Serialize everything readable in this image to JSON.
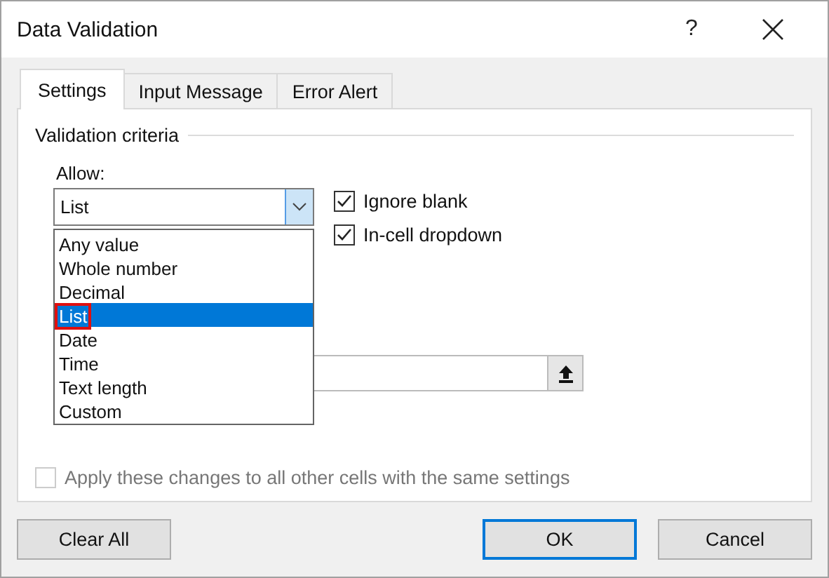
{
  "window": {
    "title": "Data Validation",
    "help": "?"
  },
  "tabs": [
    {
      "label": "Settings",
      "selected": true
    },
    {
      "label": "Input Message",
      "selected": false
    },
    {
      "label": "Error Alert",
      "selected": false
    }
  ],
  "section": {
    "title": "Validation criteria"
  },
  "allow": {
    "label": "Allow:",
    "value": "List",
    "expanded": true,
    "options": [
      {
        "label": "Any value",
        "selected": false,
        "annotated": false
      },
      {
        "label": "Whole number",
        "selected": false,
        "annotated": false
      },
      {
        "label": "Decimal",
        "selected": false,
        "annotated": false
      },
      {
        "label": "List",
        "selected": true,
        "annotated": true
      },
      {
        "label": "Date",
        "selected": false,
        "annotated": false
      },
      {
        "label": "Time",
        "selected": false,
        "annotated": false
      },
      {
        "label": "Text length",
        "selected": false,
        "annotated": false
      },
      {
        "label": "Custom",
        "selected": false,
        "annotated": false
      }
    ]
  },
  "checkboxes": [
    {
      "label": "Ignore blank",
      "checked": true
    },
    {
      "label": "In-cell dropdown",
      "checked": true
    }
  ],
  "apply_all": {
    "label": "Apply these changes to all other cells with the same settings",
    "checked": false,
    "disabled": true
  },
  "buttons": [
    {
      "label": "Clear All",
      "default": false
    },
    {
      "label": "OK",
      "default": true
    },
    {
      "label": "Cancel",
      "default": false
    }
  ]
}
